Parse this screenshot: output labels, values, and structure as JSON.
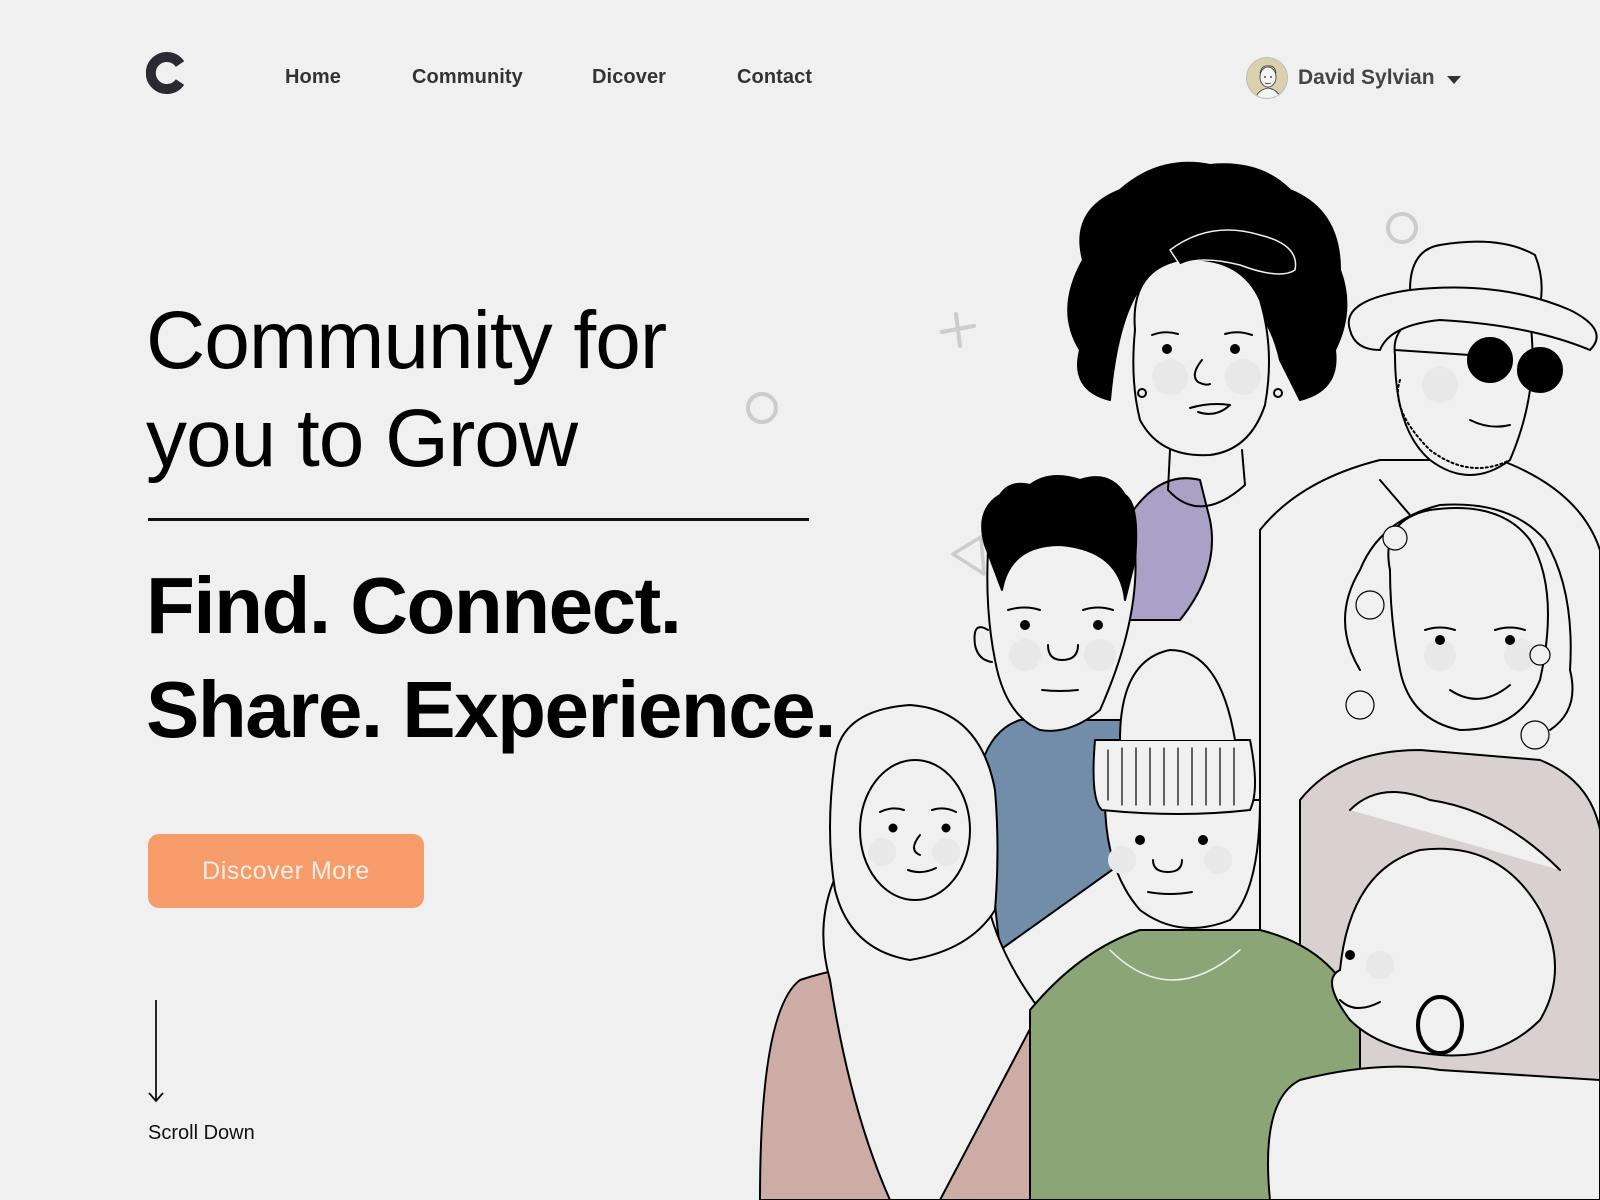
{
  "brand": {
    "logo_letter": "C",
    "logo_icon": "logo-c-icon"
  },
  "nav": {
    "items": [
      {
        "label": "Home"
      },
      {
        "label": "Community"
      },
      {
        "label": "Dicover"
      },
      {
        "label": "Contact"
      }
    ]
  },
  "user": {
    "name": "David Sylvian",
    "avatar_icon": "user-avatar-icon",
    "menu_icon": "caret-down-icon"
  },
  "hero": {
    "headline_line1": "Community for",
    "headline_line2": "you to Grow",
    "tagline_line1": "Find. Connect.",
    "tagline_line2": "Share. Experience.",
    "cta_label": "Discover More",
    "scroll_label": "Scroll Down"
  },
  "colors": {
    "background": "#f0f0f0",
    "accent": "#f59c6a",
    "text": "#000000",
    "nav_text": "#333333",
    "decor": "#cccccc",
    "shirt_purple": "#a9a1c6",
    "shirt_blue": "#728daa",
    "shirt_green": "#8ca577",
    "shirt_rose": "#cdaca5",
    "shirt_mauve": "#d9d1d1"
  }
}
